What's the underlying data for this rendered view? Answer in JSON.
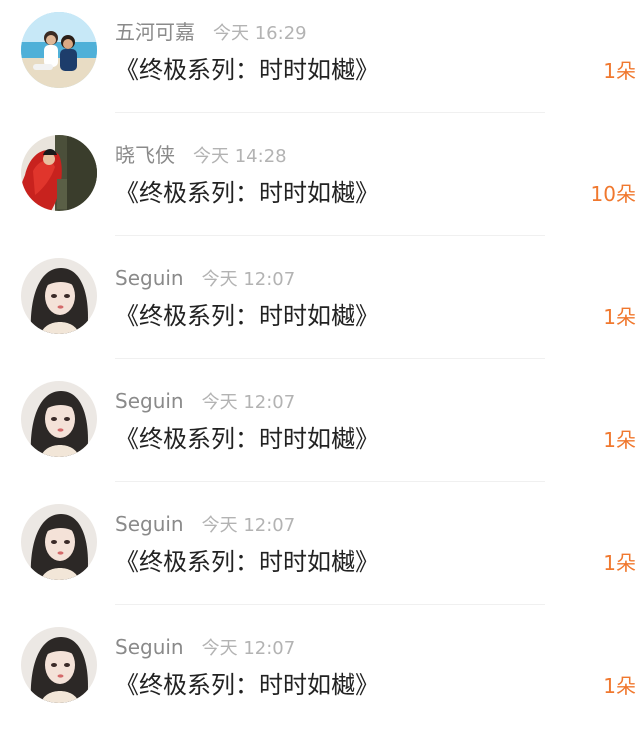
{
  "colors": {
    "name": "#8a8a8a",
    "time": "#b3b3b3",
    "gift_text": "#222222",
    "count": "#f0782e",
    "divider": "#f0f0f0"
  },
  "entries": [
    {
      "user": "五河可嘉",
      "time": "今天 16:29",
      "gift": "《终极系列：时时如樾》",
      "count": "1朵",
      "avatar": "beach-couple-avatar"
    },
    {
      "user": "晓飞侠",
      "time": "今天 14:28",
      "gift": "《终极系列：时时如樾》",
      "count": "10朵",
      "avatar": "red-costume-avatar"
    },
    {
      "user": "Seguin",
      "time": "今天 12:07",
      "gift": "《终极系列：时时如樾》",
      "count": "1朵",
      "avatar": "anime-girl-avatar"
    },
    {
      "user": "Seguin",
      "time": "今天 12:07",
      "gift": "《终极系列：时时如樾》",
      "count": "1朵",
      "avatar": "anime-girl-avatar"
    },
    {
      "user": "Seguin",
      "time": "今天 12:07",
      "gift": "《终极系列：时时如樾》",
      "count": "1朵",
      "avatar": "anime-girl-avatar"
    },
    {
      "user": "Seguin",
      "time": "今天 12:07",
      "gift": "《终极系列：时时如樾》",
      "count": "1朵",
      "avatar": "anime-girl-avatar"
    }
  ]
}
